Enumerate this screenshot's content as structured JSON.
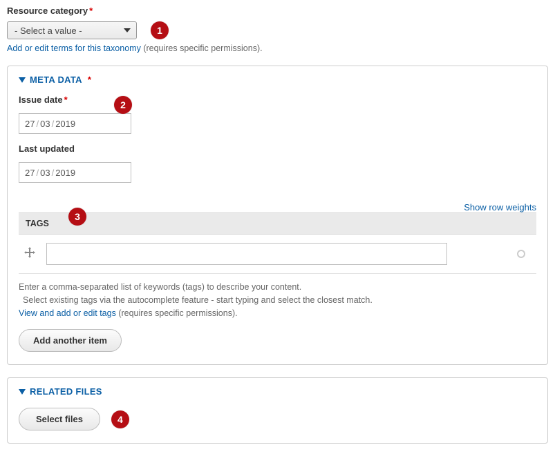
{
  "resource": {
    "label": "Resource category",
    "required_marker": "*",
    "select_placeholder": "- Select a value -",
    "taxonomy_link": "Add or edit terms for this taxonomy",
    "taxonomy_hint": " (requires specific permissions)."
  },
  "annotations": {
    "a1": "1",
    "a2": "2",
    "a3": "3",
    "a4": "4"
  },
  "meta": {
    "legend": "META DATA",
    "required_marker": "*",
    "issue_date": {
      "label": "Issue date",
      "required_marker": "*",
      "d": "27",
      "m": "03",
      "y": "2019",
      "value": "27/03/2019"
    },
    "last_updated": {
      "label": "Last updated",
      "d": "27",
      "m": "03",
      "y": "2019",
      "value": "27/03/2019"
    },
    "show_row_weights": "Show row weights",
    "tags": {
      "header": "TAGS",
      "value": "",
      "help1": "Enter a comma-separated list of keywords (tags) to describe your content.",
      "help2": "Select existing tags via the autocomplete feature - start typing and select the closest match.",
      "view_link": "View and add or edit tags",
      "view_hint": " (requires specific permissions).",
      "add_another": "Add another item"
    }
  },
  "related": {
    "legend": "RELATED FILES",
    "select_files": "Select files"
  }
}
